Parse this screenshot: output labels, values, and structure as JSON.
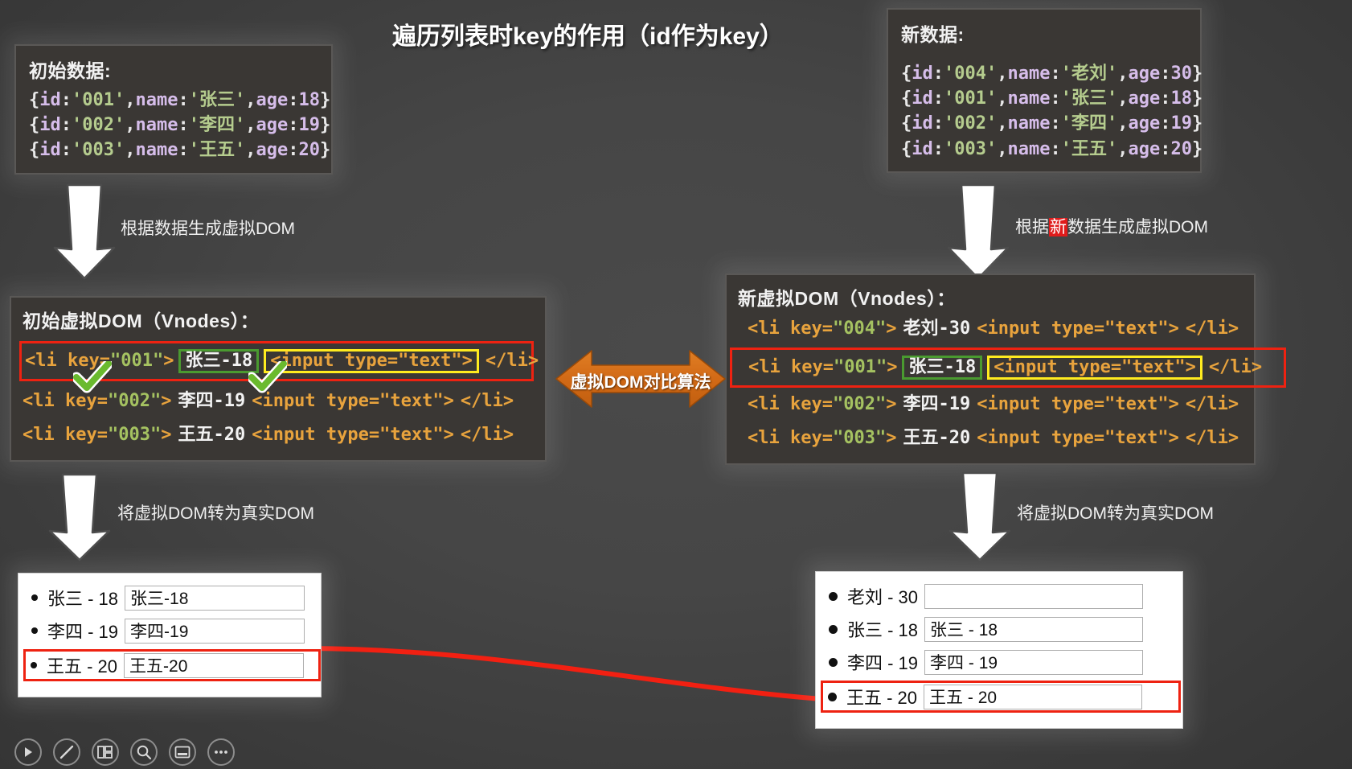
{
  "title": "遍历列表时key的作用（id作为key）",
  "initial_data": {
    "heading": "初始数据:",
    "rows": [
      {
        "id": "001",
        "name": "张三",
        "age": "18"
      },
      {
        "id": "002",
        "name": "李四",
        "age": "19"
      },
      {
        "id": "003",
        "name": "王五",
        "age": "20"
      }
    ]
  },
  "new_data": {
    "heading": "新数据:",
    "rows": [
      {
        "id": "004",
        "name": "老刘",
        "age": "30"
      },
      {
        "id": "001",
        "name": "张三",
        "age": "18"
      },
      {
        "id": "002",
        "name": "李四",
        "age": "19"
      },
      {
        "id": "003",
        "name": "王五",
        "age": "20"
      }
    ]
  },
  "annotations": {
    "left_to_vdom": "根据数据生成虚拟DOM",
    "right_to_vdom_prefix": "根据",
    "right_to_vdom_highlight": "新",
    "right_to_vdom_suffix": "数据生成虚拟DOM",
    "left_to_dom": "将虚拟DOM转为真实DOM",
    "right_to_dom": "将虚拟DOM转为真实DOM"
  },
  "diff_arrow_label": "虚拟DOM对比算法",
  "initial_vdom": {
    "heading": "初始虚拟DOM（Vnodes）：",
    "lines": [
      {
        "open": "<li key=",
        "key": "\"001\"",
        "gt": ">",
        "text": "张三-18",
        "input": "<input type=\"text\">",
        "close": "</li>",
        "highlight": "row-red",
        "text_box": "green",
        "input_box": "yellow",
        "checks": true
      },
      {
        "open": "<li key=",
        "key": "\"002\"",
        "gt": ">",
        "text": "李四-19",
        "input": "<input type=\"text\">",
        "close": "</li>",
        "highlight": "none",
        "text_box": "none",
        "input_box": "none",
        "checks": false
      },
      {
        "open": "<li key=",
        "key": "\"003\"",
        "gt": ">",
        "text": "王五-20",
        "input": "<input type=\"text\">",
        "close": "</li>",
        "highlight": "none",
        "text_box": "none",
        "input_box": "none",
        "checks": false
      }
    ]
  },
  "new_vdom": {
    "heading": "新虚拟DOM（Vnodes）：",
    "lines": [
      {
        "open": "<li key=",
        "key": "\"004\"",
        "gt": ">",
        "text": "老刘-30",
        "input": "<input type=\"text\">",
        "close": "</li>",
        "highlight": "none",
        "text_box": "none",
        "input_box": "none"
      },
      {
        "open": "<li key=",
        "key": "\"001\"",
        "gt": ">",
        "text": "张三-18",
        "input": "<input type=\"text\">",
        "close": "</li>",
        "highlight": "row-red",
        "text_box": "green",
        "input_box": "yellow"
      },
      {
        "open": "<li key=",
        "key": "\"002\"",
        "gt": ">",
        "text": "李四-19",
        "input": "<input type=\"text\">",
        "close": "</li>",
        "highlight": "none",
        "text_box": "none",
        "input_box": "none"
      },
      {
        "open": "<li key=",
        "key": "\"003\"",
        "gt": ">",
        "text": "王五-20",
        "input": "<input type=\"text\">",
        "close": "</li>",
        "highlight": "none",
        "text_box": "none",
        "input_box": "none"
      }
    ]
  },
  "initial_realdom": {
    "rows": [
      {
        "label": "张三 - 18",
        "value": "张三-18",
        "flagged": false
      },
      {
        "label": "李四 - 19",
        "value": "李四-19",
        "flagged": false
      },
      {
        "label": "王五 - 20",
        "value": "王五-20",
        "flagged": true
      }
    ]
  },
  "new_realdom": {
    "rows": [
      {
        "label": "老刘 - 30",
        "value": "",
        "flagged": false
      },
      {
        "label": "张三 - 18",
        "value": "张三 - 18",
        "flagged": false
      },
      {
        "label": "李四 - 19",
        "value": "李四 - 19",
        "flagged": false
      },
      {
        "label": "王五 - 20",
        "value": "王五 - 20",
        "flagged": true
      }
    ]
  },
  "toolbar": {
    "items": [
      {
        "name": "play-icon",
        "glyph": "▶"
      },
      {
        "name": "pen-icon",
        "glyph": "/"
      },
      {
        "name": "layout-icon",
        "glyph": "▤"
      },
      {
        "name": "search-icon",
        "glyph": "🔍"
      },
      {
        "name": "slide-icon",
        "glyph": "▭"
      },
      {
        "name": "more-icon",
        "glyph": "•••"
      }
    ]
  },
  "colors": {
    "background": "#464646",
    "panel": "#3a3734",
    "red": "#ee2211",
    "green": "#4a9a30",
    "yellow": "#ffeb1f",
    "orange": "#d9741d",
    "code_string": "#a5c261",
    "code_tag": "#e8a33d",
    "highlight_red": "#e01b1b"
  }
}
